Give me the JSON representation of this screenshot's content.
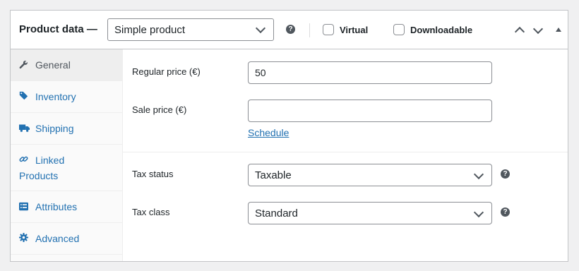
{
  "header": {
    "title": "Product data —",
    "product_type": {
      "selected": "Simple product"
    },
    "help_icon": "question-circle-icon",
    "virtual_label": "Virtual",
    "virtual_checked": false,
    "downloadable_label": "Downloadable",
    "downloadable_checked": false
  },
  "tabs": [
    {
      "label": "General",
      "icon": "wrench-icon",
      "active": true
    },
    {
      "label": "Inventory",
      "icon": "tag-icon",
      "active": false
    },
    {
      "label": "Shipping",
      "icon": "truck-icon",
      "active": false
    },
    {
      "label_line1": "Linked",
      "label_line2": "Products",
      "icon": "link-icon",
      "active": false
    },
    {
      "label": "Attributes",
      "icon": "list-icon",
      "active": false
    },
    {
      "label": "Advanced",
      "icon": "gear-icon",
      "active": false
    }
  ],
  "general": {
    "regular_price_label": "Regular price (€)",
    "regular_price_value": "50",
    "sale_price_label": "Sale price (€)",
    "sale_price_value": "",
    "schedule_link": "Schedule",
    "tax_status_label": "Tax status",
    "tax_status_value": "Taxable",
    "tax_class_label": "Tax class",
    "tax_class_value": "Standard"
  },
  "colors": {
    "link": "#2271b1",
    "border": "#c3c4c7",
    "background": "#f0f0f1",
    "tab_active_bg": "#eeeeee"
  }
}
